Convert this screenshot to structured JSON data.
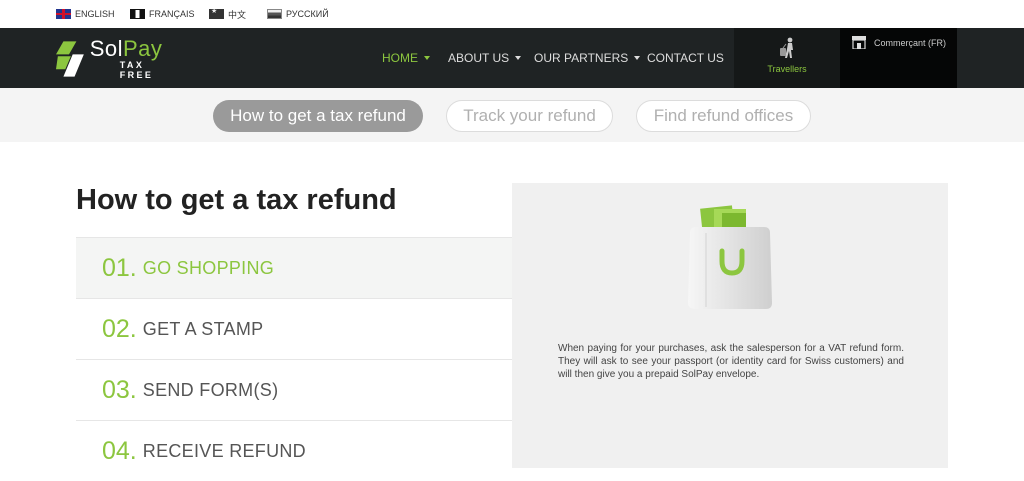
{
  "languages": [
    {
      "label": "ENGLISH",
      "flag": "uk-flag-icon"
    },
    {
      "label": "FRANÇAIS",
      "flag": "france-flag-icon"
    },
    {
      "label": "中文",
      "flag": "china-flag-icon"
    },
    {
      "label": "РУССКИЙ",
      "flag": "russia-flag-icon"
    }
  ],
  "brand": {
    "sol": "Sol",
    "pay": "Pay",
    "tagline": "TAX FREE",
    "accent": "#8cc63f",
    "dark": "#1f2324"
  },
  "nav": [
    {
      "label": "HOME",
      "active": true,
      "dropdown": true
    },
    {
      "label": "ABOUT US",
      "active": false,
      "dropdown": true
    },
    {
      "label": "OUR PARTNERS",
      "active": false,
      "dropdown": true
    },
    {
      "label": "CONTACT US",
      "active": false,
      "dropdown": false
    }
  ],
  "travellers": {
    "label": "Travellers",
    "icon": "traveller-luggage-icon"
  },
  "merchant": {
    "label": "Commerçant (FR)",
    "icon": "shop-icon"
  },
  "tabs": [
    {
      "label": "How to get a tax refund",
      "active": true
    },
    {
      "label": "Track your refund",
      "active": false
    },
    {
      "label": "Find refund offices",
      "active": false
    }
  ],
  "main": {
    "title": "How to get a tax refund",
    "steps": [
      {
        "num": "01.",
        "label": "GO SHOPPING",
        "active": true
      },
      {
        "num": "02.",
        "label": "GET A STAMP",
        "active": false
      },
      {
        "num": "03.",
        "label": "SEND FORM(S)",
        "active": false
      },
      {
        "num": "04.",
        "label": "RECEIVE REFUND",
        "active": false
      }
    ],
    "panel": {
      "icon": "shopping-bag-icon",
      "text": "When paying for your purchases, ask the salesperson for a VAT refund form. They will ask to see your passport (or identity card for Swiss customers) and will then give you a prepaid SolPay envelope."
    }
  }
}
